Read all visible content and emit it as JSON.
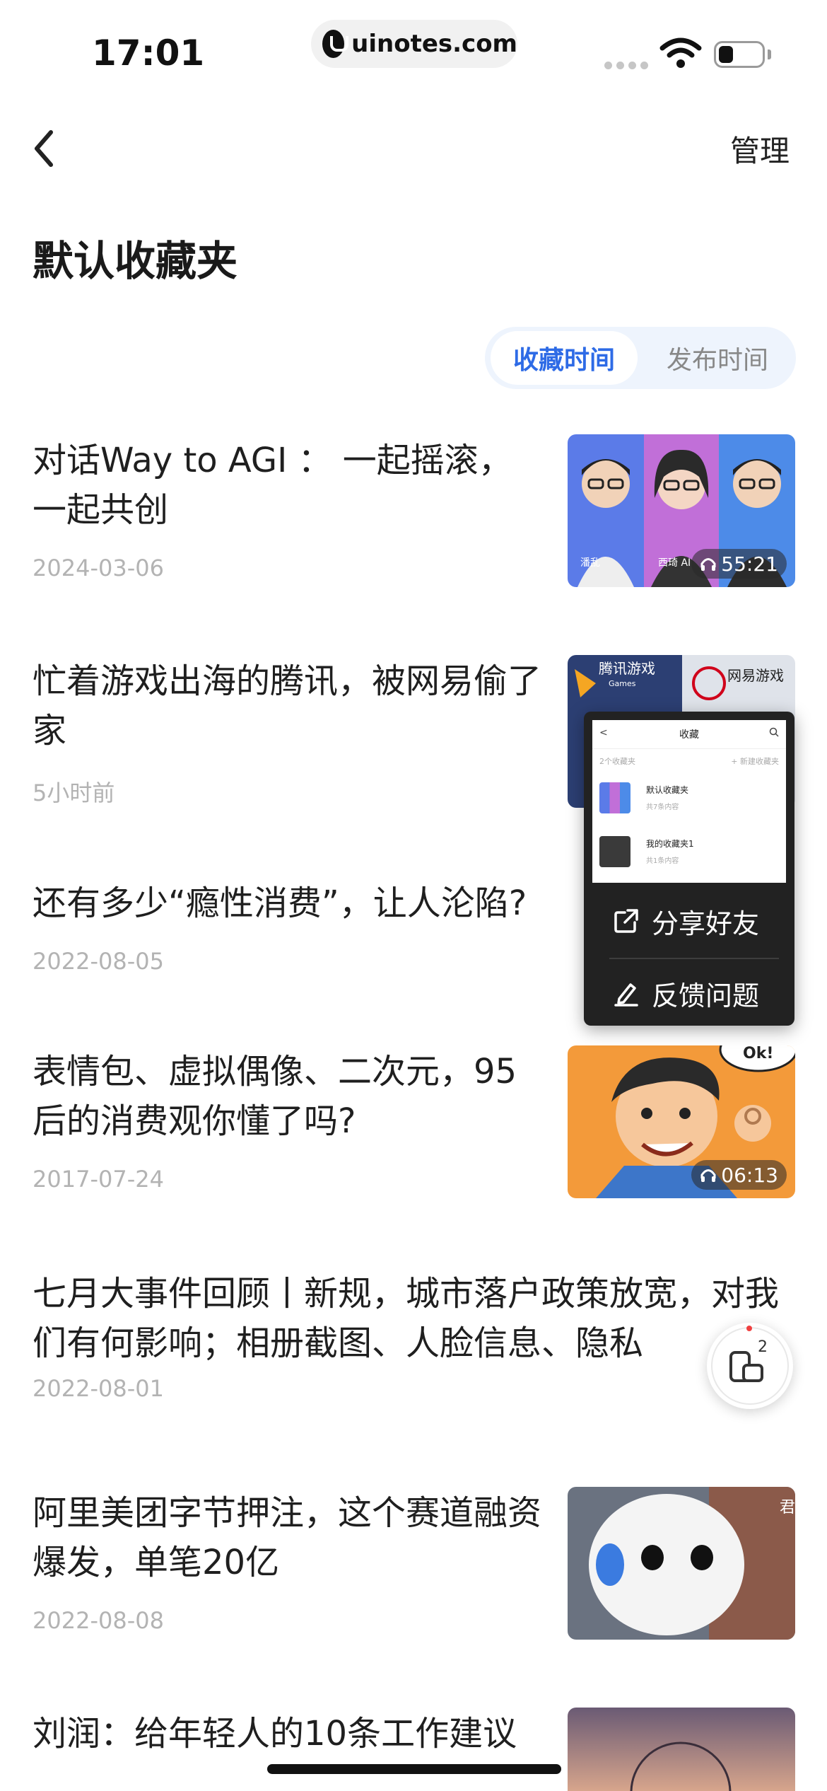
{
  "status_bar": {
    "time": "17:01",
    "url": "uinotes.com",
    "battery_level": 0.35
  },
  "nav": {
    "manage_label": "管理"
  },
  "page": {
    "title": "默认收藏夹"
  },
  "sort": {
    "tabs": [
      {
        "label": "收藏时间",
        "active": true
      },
      {
        "label": "发布时间",
        "active": false
      }
    ]
  },
  "articles": [
    {
      "title": "对话Way to AGI ： 一起摇滚，一起共创",
      "date": "2024-03-06",
      "thumb": "three-avatar-podcast",
      "duration": "55:21",
      "thumb_captions": [
        "潘乱",
        "西琦 AI",
        ""
      ]
    },
    {
      "title": "忙着游戏出海的腾讯，被网易偷了家",
      "date": "5小时前",
      "thumb": "game-company-logos",
      "thumb_captions": [
        "腾讯游戏",
        "Games",
        "网易游戏"
      ]
    },
    {
      "title": "还有多少“瘾性消费”，让人沦陷?",
      "date": "2022-08-05"
    },
    {
      "title": "表情包、虚拟偶像、二次元，95后的消费观你懂了吗?",
      "date": "2017-07-24",
      "thumb": "comic-ok-man",
      "duration": "06:13",
      "thumb_captions": [
        "Ok!"
      ]
    },
    {
      "title": "七月大事件回顾丨新规，城市落户政策放宽，对我们有何影响；相册截图、人脸信息、隐私",
      "date": "2022-08-01"
    },
    {
      "title": "阿里美团字节押注，这个赛道融资爆发，单笔20亿",
      "date": "2022-08-08",
      "thumb": "humanoid-robot",
      "thumb_captions": [
        "君"
      ]
    },
    {
      "title": "刘润：给年轻人的10条工作建议",
      "date": "",
      "thumb": "sunset-ferris"
    }
  ],
  "popup": {
    "mini_screen": {
      "title": "收藏",
      "count_label": "2个收藏夹",
      "add_label": "+ 新建收藏夹",
      "folders": [
        {
          "name": "默认收藏夹",
          "count": "共7条内容"
        },
        {
          "name": "我的收藏夹1",
          "count": "共1条内容"
        }
      ]
    },
    "items": [
      {
        "label": "分享好友",
        "icon": "share-icon"
      },
      {
        "label": "反馈问题",
        "icon": "edit-icon"
      }
    ]
  },
  "float_button": {
    "badge": "2",
    "icon": "screenshot-icon"
  },
  "colors": {
    "accent": "#2e6be6",
    "date_gray": "#b3b3b3",
    "popup_bg": "#222222"
  }
}
